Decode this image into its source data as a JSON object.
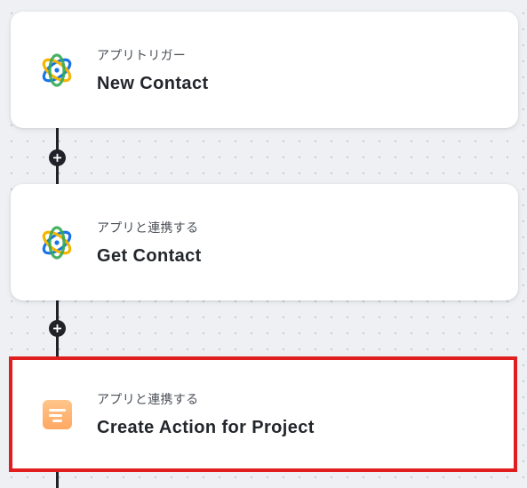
{
  "flow": {
    "steps": [
      {
        "subtitle": "アプリトリガー",
        "title": "New Contact",
        "icon": "app-orbit-icon"
      },
      {
        "subtitle": "アプリと連携する",
        "title": "Get Contact",
        "icon": "app-orbit-icon"
      },
      {
        "subtitle": "アプリと連携する",
        "title": "Create Action for Project",
        "icon": "project-app-icon",
        "selected": true
      }
    ],
    "add_step_icon": "plus-icon",
    "colors": {
      "background": "#eef0f3",
      "selected_border": "#e01e1e",
      "connector": "#1f2329",
      "project_icon": "#ffb06e"
    }
  }
}
